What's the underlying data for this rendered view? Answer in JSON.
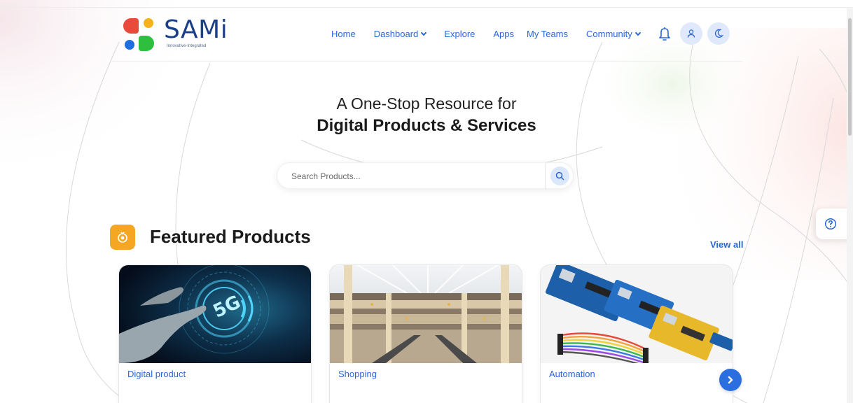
{
  "brand": {
    "name": "SAMi",
    "tagline": "Innovative-Integrated",
    "colors": {
      "red": "#e84a3c",
      "yellow": "#f6b21b",
      "blue": "#1e6fe0",
      "green": "#2fbf3e",
      "text": "#1c3f8a"
    }
  },
  "nav": {
    "items": [
      {
        "label": "Home",
        "dropdown": false
      },
      {
        "label": "Dashboard",
        "dropdown": true
      },
      {
        "label": "Explore",
        "dropdown": false
      },
      {
        "label": "Apps",
        "dropdown": false
      },
      {
        "label": "My Teams",
        "dropdown": false
      },
      {
        "label": "Community",
        "dropdown": true
      }
    ],
    "icons": [
      "bell-icon",
      "user-icon",
      "moon-icon"
    ]
  },
  "hero": {
    "line1": "A One-Stop Resource for",
    "line2": "Digital Products & Services"
  },
  "search": {
    "placeholder": "Search Products...",
    "value": ""
  },
  "featured": {
    "title": "Featured Products",
    "view_all": "View all",
    "cards": [
      {
        "label": "Digital product",
        "image": "5g-hand-image"
      },
      {
        "label": "Shopping",
        "image": "shopping-mall-image"
      },
      {
        "label": "Automation",
        "image": "arduino-boards-image"
      }
    ]
  },
  "accent": "#2a67d6"
}
